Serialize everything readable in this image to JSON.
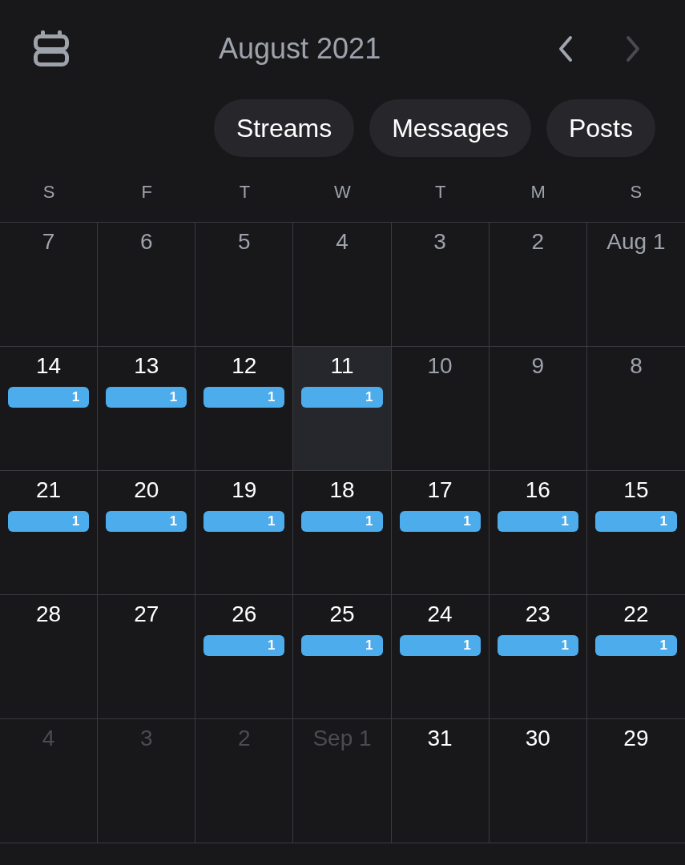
{
  "header": {
    "title": "August 2021",
    "nav": [
      {
        "kind": "prev",
        "disabled": false
      },
      {
        "kind": "next",
        "disabled": true
      }
    ]
  },
  "filters": [
    {
      "label": "Streams"
    },
    {
      "label": "Messages"
    },
    {
      "label": "Posts"
    }
  ],
  "weekdays": [
    "S",
    "F",
    "T",
    "W",
    "T",
    "M",
    "S"
  ],
  "weeks": [
    [
      {
        "label": "7",
        "kind": "past",
        "selected": false
      },
      {
        "label": "6",
        "kind": "past",
        "selected": false
      },
      {
        "label": "5",
        "kind": "past",
        "selected": false
      },
      {
        "label": "4",
        "kind": "past",
        "selected": false
      },
      {
        "label": "3",
        "kind": "past",
        "selected": false
      },
      {
        "label": "2",
        "kind": "past",
        "selected": false
      },
      {
        "label": "Aug 1",
        "kind": "past",
        "selected": false
      }
    ],
    [
      {
        "label": "14",
        "kind": "current",
        "selected": false,
        "badge": "1"
      },
      {
        "label": "13",
        "kind": "current",
        "selected": false,
        "badge": "1"
      },
      {
        "label": "12",
        "kind": "current",
        "selected": false,
        "badge": "1"
      },
      {
        "label": "11",
        "kind": "current",
        "selected": true,
        "badge": "1"
      },
      {
        "label": "10",
        "kind": "past",
        "selected": false
      },
      {
        "label": "9",
        "kind": "past",
        "selected": false
      },
      {
        "label": "8",
        "kind": "past",
        "selected": false
      }
    ],
    [
      {
        "label": "21",
        "kind": "current",
        "selected": false,
        "badge": "1"
      },
      {
        "label": "20",
        "kind": "current",
        "selected": false,
        "badge": "1"
      },
      {
        "label": "19",
        "kind": "current",
        "selected": false,
        "badge": "1"
      },
      {
        "label": "18",
        "kind": "current",
        "selected": false,
        "badge": "1"
      },
      {
        "label": "17",
        "kind": "current",
        "selected": false,
        "badge": "1"
      },
      {
        "label": "16",
        "kind": "current",
        "selected": false,
        "badge": "1"
      },
      {
        "label": "15",
        "kind": "current",
        "selected": false,
        "badge": "1"
      }
    ],
    [
      {
        "label": "28",
        "kind": "current",
        "selected": false
      },
      {
        "label": "27",
        "kind": "current",
        "selected": false
      },
      {
        "label": "26",
        "kind": "current",
        "selected": false,
        "badge": "1"
      },
      {
        "label": "25",
        "kind": "current",
        "selected": false,
        "badge": "1"
      },
      {
        "label": "24",
        "kind": "current",
        "selected": false,
        "badge": "1"
      },
      {
        "label": "23",
        "kind": "current",
        "selected": false,
        "badge": "1"
      },
      {
        "label": "22",
        "kind": "current",
        "selected": false,
        "badge": "1"
      }
    ],
    [
      {
        "label": "4",
        "kind": "next_month",
        "selected": false
      },
      {
        "label": "3",
        "kind": "next_month",
        "selected": false
      },
      {
        "label": "2",
        "kind": "next_month",
        "selected": false
      },
      {
        "label": "Sep 1",
        "kind": "next_month",
        "selected": false
      },
      {
        "label": "31",
        "kind": "current",
        "selected": false
      },
      {
        "label": "30",
        "kind": "current",
        "selected": false
      },
      {
        "label": "29",
        "kind": "current",
        "selected": false
      }
    ]
  ]
}
